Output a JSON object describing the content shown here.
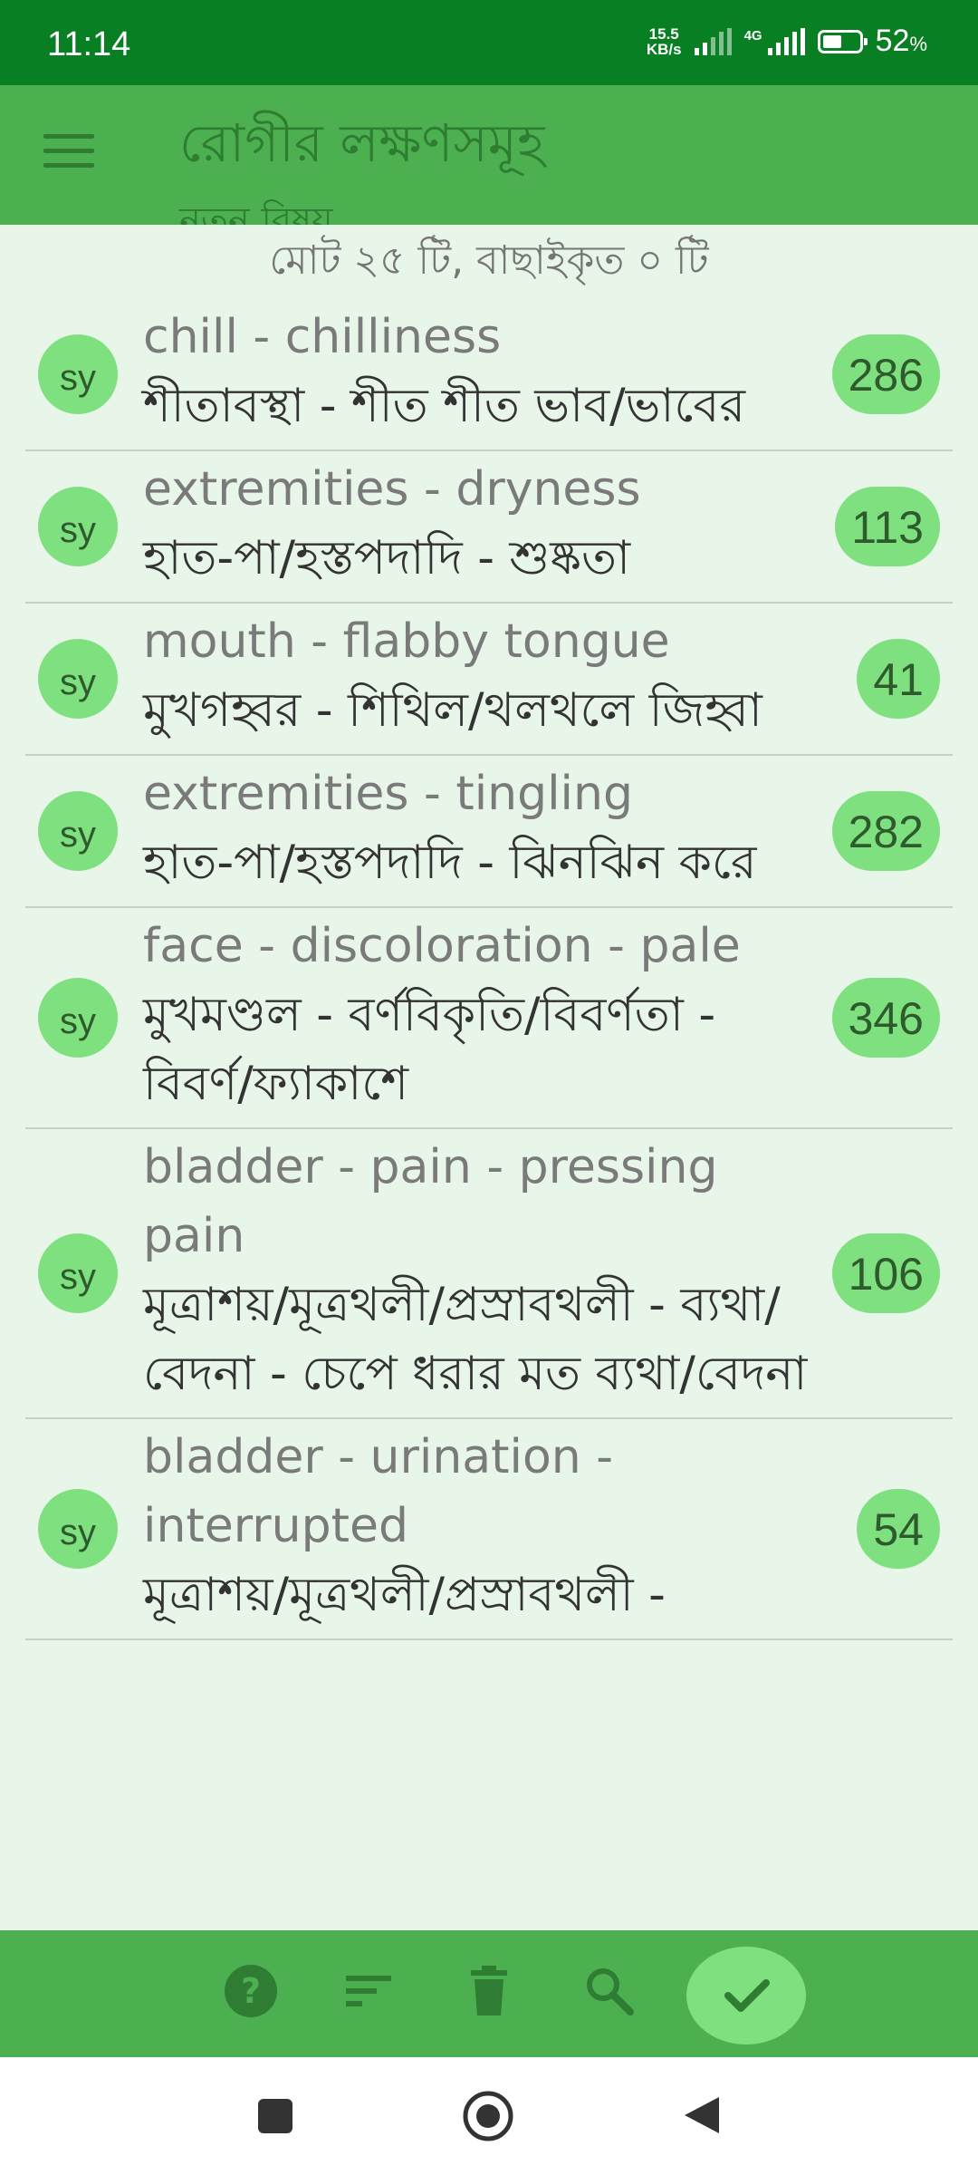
{
  "status": {
    "time": "11:14",
    "net_speed_value": "15.5",
    "net_speed_unit": "KB/s",
    "network_label": "4G",
    "battery_percent": "52",
    "battery_unit": "%",
    "battery_level": 0.52
  },
  "appbar": {
    "title": "রোগীর লক্ষণসমূহ",
    "subtitle": "নতুন বিষয়",
    "menu_icon": "hamburger-menu-icon"
  },
  "summary": "মোট ২৫ টি, বাছাইকৃত ০ টি",
  "rows": [
    {
      "tag": "sy",
      "en": "chill - chilliness",
      "bn": "শীতাবস্থা - শীত শীত ভাব/ভাবের",
      "count": "286"
    },
    {
      "tag": "sy",
      "en": "extremities - dryness",
      "bn": "হাত-পা/হস্তপদাদি - শুষ্কতা",
      "count": "113"
    },
    {
      "tag": "sy",
      "en": "mouth - flabby tongue",
      "bn": "মুখগহ্বর - শিথিল/থলথলে জিহ্বা",
      "count": "41"
    },
    {
      "tag": "sy",
      "en": "extremities - tingling",
      "bn": "হাত-পা/হস্তপদাদি - ঝিনঝিন করে",
      "count": "282"
    },
    {
      "tag": "sy",
      "en": "face - discoloration - pale",
      "bn": "মুখমণ্ডল - বর্ণবিকৃতি/বিবর্ণতা - বিবর্ণ/ফ্যাকাশে",
      "count": "346"
    },
    {
      "tag": "sy",
      "en": "bladder - pain - pressing pain",
      "bn": "মূত্রাশয়/মূত্রথলী/প্রস্রাবথলী - ব্যথা/বেদনা - চেপে ধরার মত ব্যথা/বেদনা",
      "count": "106"
    },
    {
      "tag": "sy",
      "en": "bladder - urination - interrupted",
      "bn": "মূত্রাশয়/মূত্রথলী/প্রস্রাবথলী -",
      "count": "54"
    }
  ],
  "bottom_bar": {
    "icons": [
      "help-icon",
      "sort-icon",
      "delete-icon",
      "search-icon",
      "check-icon"
    ]
  },
  "navbar": {
    "icons": [
      "recents-square-icon",
      "home-circle-icon",
      "back-triangle-icon"
    ]
  },
  "colors": {
    "status_bar": "#087f23",
    "app_bar": "#4caf50",
    "background": "#e8f5e9",
    "badge": "#7ee07e",
    "dark_green": "#2e7d32"
  }
}
